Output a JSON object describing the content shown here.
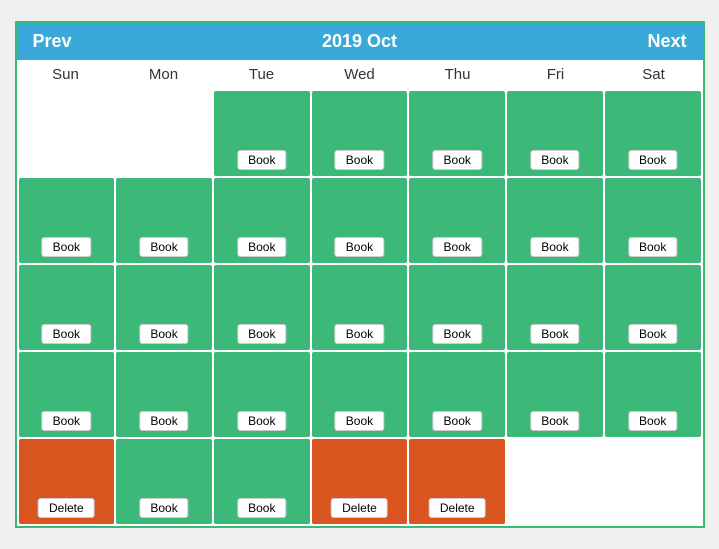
{
  "header": {
    "prev_label": "Prev",
    "next_label": "Next",
    "title": "2019 Oct"
  },
  "weekdays": [
    "Sun",
    "Mon",
    "Tue",
    "Wed",
    "Thu",
    "Fri",
    "Sat"
  ],
  "rows": [
    [
      {
        "type": "empty",
        "btn": null
      },
      {
        "type": "empty",
        "btn": null
      },
      {
        "type": "green",
        "btn": "Book"
      },
      {
        "type": "green",
        "btn": "Book"
      },
      {
        "type": "green",
        "btn": "Book"
      },
      {
        "type": "green",
        "btn": "Book"
      },
      {
        "type": "green",
        "btn": "Book"
      }
    ],
    [
      {
        "type": "green",
        "btn": "Book"
      },
      {
        "type": "green",
        "btn": "Book"
      },
      {
        "type": "green",
        "btn": "Book"
      },
      {
        "type": "green",
        "btn": "Book"
      },
      {
        "type": "green",
        "btn": "Book"
      },
      {
        "type": "green",
        "btn": "Book"
      },
      {
        "type": "green",
        "btn": "Book"
      }
    ],
    [
      {
        "type": "green",
        "btn": "Book"
      },
      {
        "type": "green",
        "btn": "Book"
      },
      {
        "type": "green",
        "btn": "Book"
      },
      {
        "type": "green",
        "btn": "Book"
      },
      {
        "type": "green",
        "btn": "Book"
      },
      {
        "type": "green",
        "btn": "Book"
      },
      {
        "type": "green",
        "btn": "Book"
      }
    ],
    [
      {
        "type": "green",
        "btn": "Book"
      },
      {
        "type": "green",
        "btn": "Book"
      },
      {
        "type": "green",
        "btn": "Book"
      },
      {
        "type": "green",
        "btn": "Book"
      },
      {
        "type": "green",
        "btn": "Book"
      },
      {
        "type": "green",
        "btn": "Book"
      },
      {
        "type": "green",
        "btn": "Book"
      }
    ],
    [
      {
        "type": "orange",
        "btn": "Delete"
      },
      {
        "type": "green",
        "btn": "Book"
      },
      {
        "type": "green",
        "btn": "Book"
      },
      {
        "type": "orange",
        "btn": "Delete"
      },
      {
        "type": "orange",
        "btn": "Delete"
      },
      {
        "type": "empty",
        "btn": null
      },
      {
        "type": "empty",
        "btn": null
      }
    ]
  ]
}
